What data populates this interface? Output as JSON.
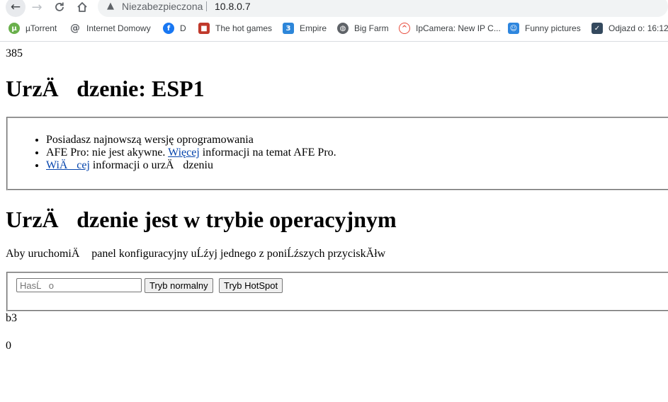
{
  "browser": {
    "insecure_label": "Niezabezpieczona",
    "url": "10.8.0.7",
    "bookmarks": [
      {
        "label": "µTorrent",
        "icon": "utorrent-icon",
        "color": "#6ab04c"
      },
      {
        "label": "Internet Domowy",
        "icon": "at-icon",
        "color": "#5f6368"
      },
      {
        "label": "D",
        "icon": "facebook-icon",
        "color": "#1877f2"
      },
      {
        "label": "The hot games",
        "icon": "game-cube-icon",
        "color": "#c0392b"
      },
      {
        "label": "Empire",
        "icon": "empire-icon",
        "color": "#2d86d9"
      },
      {
        "label": "Big Farm",
        "icon": "globe-icon",
        "color": "#5f6368"
      },
      {
        "label": "IpCamera: New IP C...",
        "icon": "ipcamera-icon",
        "color": "#e74c3c"
      },
      {
        "label": "Funny pictures",
        "icon": "funny-icon",
        "color": "#2e86de"
      },
      {
        "label": "Odjazd o: 16:12",
        "icon": "check-chart-icon",
        "color": "#34495e"
      }
    ]
  },
  "page": {
    "counter_top": "385",
    "device_title": "UrzÄdzenie: ESP1",
    "info": {
      "line1": "Posiadasz najnowszą wersję oprogramowania",
      "line2_pre": "AFE Pro: nie jest akywne. ",
      "line2_link": "Więcej",
      "line2_post": " informacji na temat AFE Pro.",
      "line3_link": "WiÄcej",
      "line3_post": " informacji o urzÄdzeniu"
    },
    "mode_title": "UrzÄdzenie jest w trybie operacyjnym",
    "intro_text": "Aby uruchomiÄ panel konfiguracyjny uĹźyj jednego z poniĹźszych przyciskĂłw",
    "password_placeholder": "HasĹo",
    "btn_normal": "Tryb normalny",
    "btn_hotspot": "Tryb HotSpot",
    "footer_line1": "b3",
    "footer_line2": "0"
  }
}
